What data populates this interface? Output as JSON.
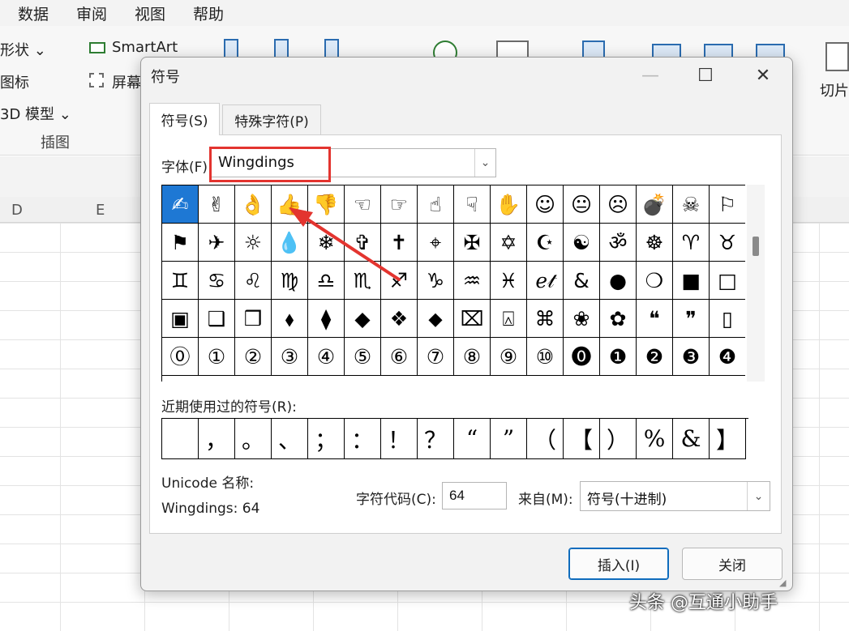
{
  "excel": {
    "menu": [
      "数据",
      "审阅",
      "视图",
      "帮助"
    ],
    "ribbon": {
      "shapes": "形状",
      "icons": "图标",
      "model3d": "3D 模型",
      "smartart": "SmartArt",
      "screenshot": "屏幕",
      "group": "插图",
      "slicer": "切片"
    },
    "columns": [
      "D",
      "E"
    ]
  },
  "dialog": {
    "title": "符号",
    "tabs": [
      {
        "label": "符号(S)",
        "active": true
      },
      {
        "label": "特殊字符(P)",
        "active": false
      }
    ],
    "font_label": "字体(F):",
    "font_value": "Wingdings",
    "symbols": [
      "✍",
      "✌",
      "👌",
      "👍",
      "👎",
      "☜",
      "☞",
      "☝",
      "☟",
      "✋",
      "☺",
      "😐",
      "☹",
      "💣",
      "☠",
      "⚐",
      "⚑",
      "✈",
      "☼",
      "💧",
      "❄",
      "✞",
      "✝",
      "⌖",
      "✠",
      "✡",
      "☪",
      "☯",
      "ॐ",
      "☸",
      "♈",
      "♉",
      "♊",
      "♋",
      "♌",
      "♍",
      "♎",
      "♏",
      "♐",
      "♑",
      "♒",
      "♓",
      "ℯ𝓉",
      "&",
      "●",
      "❍",
      "■",
      "□",
      "▣",
      "❑",
      "❒",
      "⬧",
      "⧫",
      "◆",
      "❖",
      "⬥",
      "⌧",
      "⍓",
      "⌘",
      "❀",
      "✿",
      "❝",
      "❞",
      "▯",
      "⓪",
      "①",
      "②",
      "③",
      "④",
      "⑤",
      "⑥",
      "⑦",
      "⑧",
      "⑨",
      "⑩",
      "⓿",
      "❶",
      "❷",
      "❸",
      "❹"
    ],
    "selected_index": 0,
    "recent_label": "近期使用过的符号(R):",
    "recent_symbols": [
      "",
      "，",
      "。",
      "、",
      "；",
      "：",
      "！",
      "？",
      "“",
      "”",
      "（",
      "【",
      "）",
      "%",
      "&",
      "】"
    ],
    "unicode_name_label": "Unicode 名称:",
    "unicode_name_value": "Wingdings: 64",
    "char_code_label": "字符代码(C):",
    "char_code_value": "64",
    "from_label": "来自(M):",
    "from_value": "符号(十进制)",
    "insert_button": "插入(I)",
    "close_button": "关闭"
  },
  "watermark": "头条 @互通小助手",
  "colors": {
    "accent": "#1e78d4",
    "highlight": "#e3342f"
  }
}
